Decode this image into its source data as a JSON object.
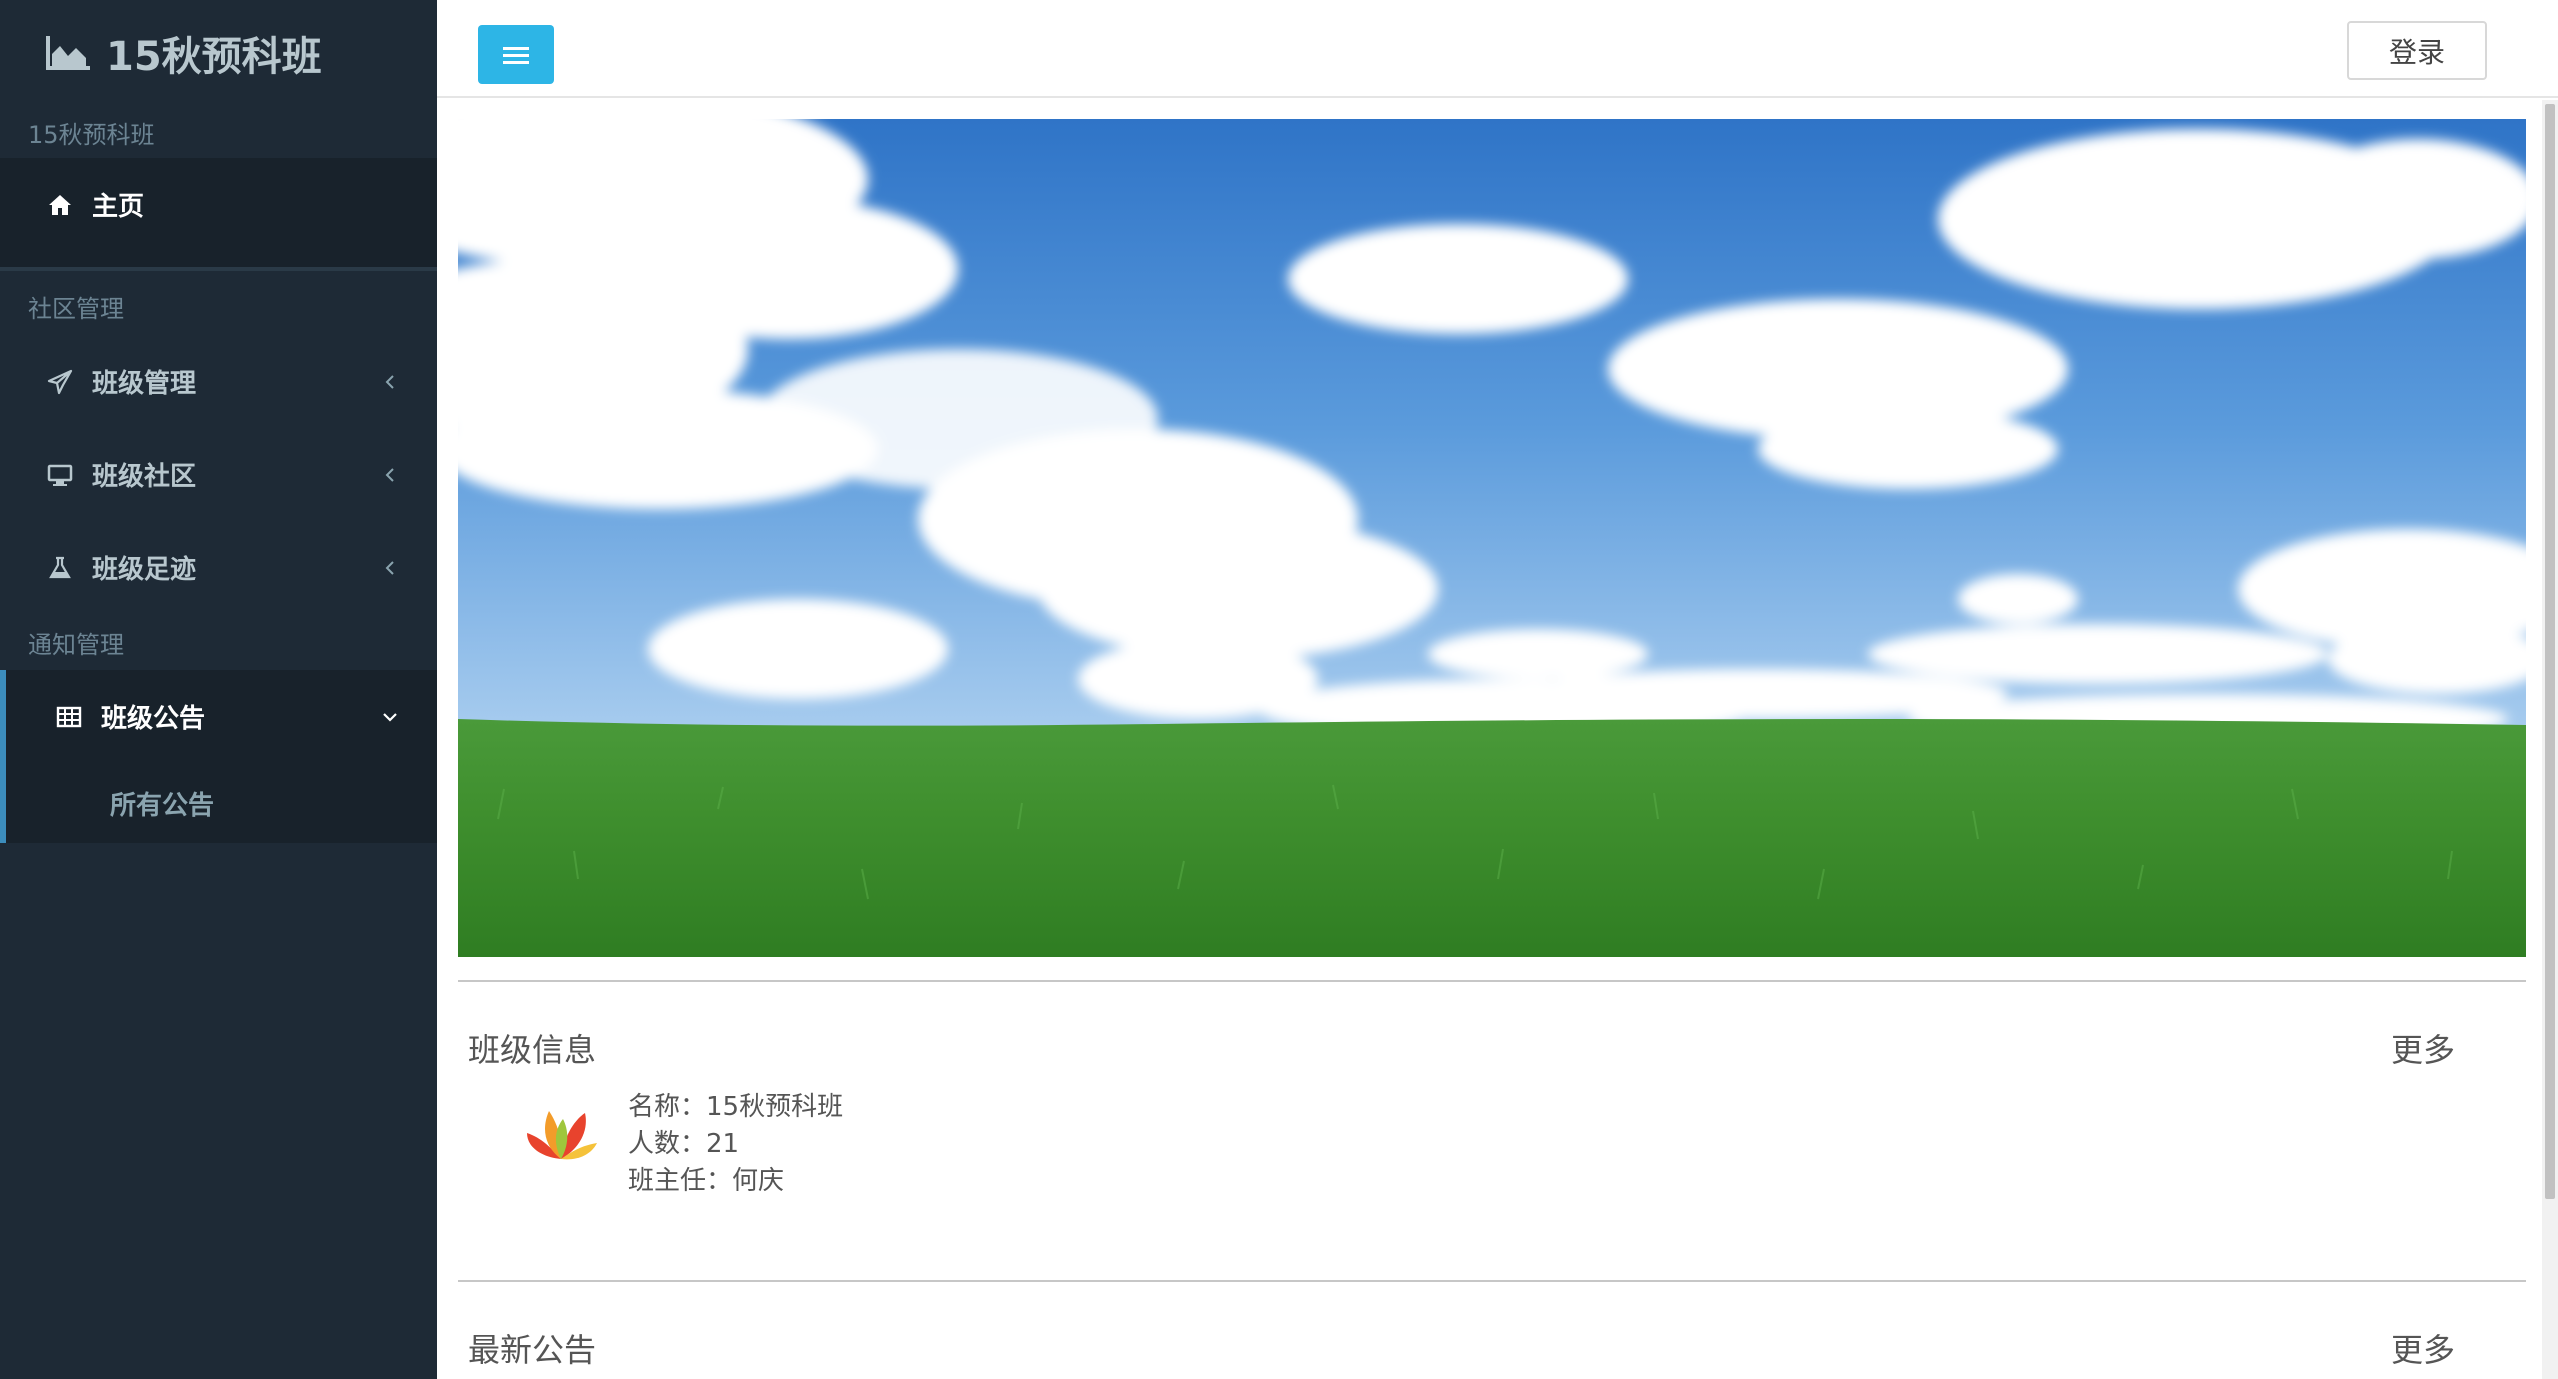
{
  "sidebar": {
    "brand": "15秋预科班",
    "sections": [
      {
        "header": "15秋预科班"
      },
      {
        "header": "社区管理"
      },
      {
        "header": "通知管理"
      }
    ],
    "home": "主页",
    "community": [
      "班级管理",
      "班级社区",
      "班级足迹"
    ],
    "notice_group": "班级公告",
    "notice_sub": "所有公告"
  },
  "topbar": {
    "login_label": "登录"
  },
  "main": {
    "class_info": {
      "title": "班级信息",
      "more": "更多",
      "name_line": "名称：15秋预科班",
      "count_line": "人数：21",
      "teacher_line": "班主任：何庆"
    },
    "latest_notice": {
      "title": "最新公告",
      "more": "更多"
    }
  },
  "colors": {
    "sidebar_bg": "#1e2a36",
    "active_bg": "#18222b",
    "accent": "#2db5e6",
    "active_border": "#3c8dbc"
  },
  "icons": {
    "brand": "area-chart-icon",
    "home": "home-icon",
    "class_manage": "paper-plane-icon",
    "class_community": "desktop-icon",
    "class_footprint": "flask-icon",
    "notice": "table-icon",
    "toggle": "bars-icon"
  }
}
